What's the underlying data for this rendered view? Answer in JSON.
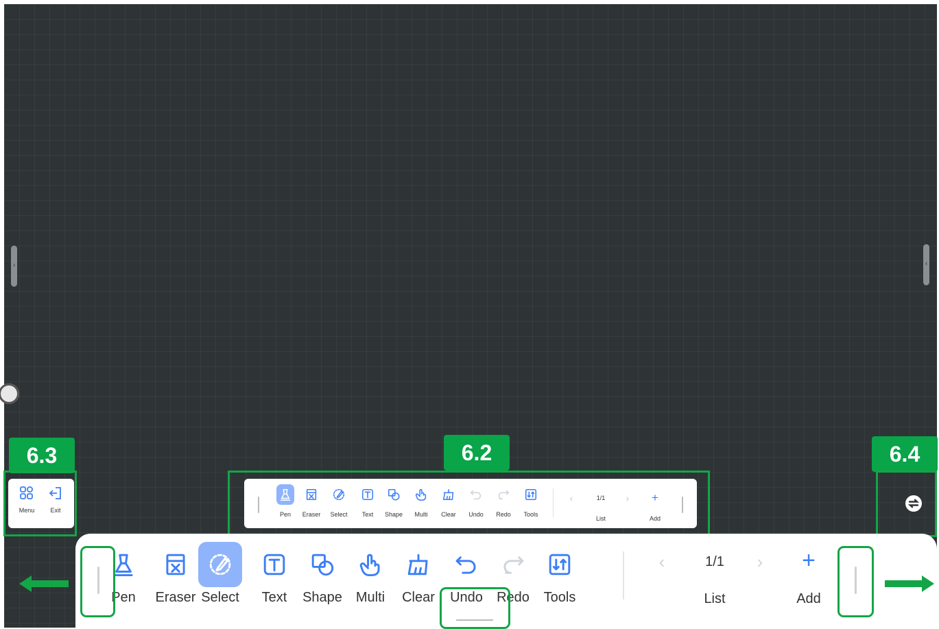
{
  "callouts": {
    "left": "6.3",
    "center": "6.2",
    "right": "6.4"
  },
  "colors": {
    "accent": "#3d7ff5",
    "active_bg": "#8fb4fb",
    "callout_green": "#0aa449",
    "canvas": "#2e3436",
    "disabled": "#cfd4da"
  },
  "left_panel": {
    "menu": {
      "label": "Menu",
      "icon": "menu-grid-icon"
    },
    "exit": {
      "label": "Exit",
      "icon": "exit-icon"
    }
  },
  "small_toolbar": {
    "tools": [
      {
        "label": "Pen",
        "icon": "pen-icon",
        "active": true
      },
      {
        "label": "Eraser",
        "icon": "eraser-icon"
      },
      {
        "label": "Select",
        "icon": "select-icon"
      },
      {
        "label": "Text",
        "icon": "text-icon"
      },
      {
        "label": "Shape",
        "icon": "shape-icon"
      },
      {
        "label": "Multi",
        "icon": "multi-touch-icon"
      },
      {
        "label": "Clear",
        "icon": "clear-icon"
      },
      {
        "label": "Undo",
        "icon": "undo-icon",
        "disabled": true
      },
      {
        "label": "Redo",
        "icon": "redo-icon",
        "disabled": true
      },
      {
        "label": "Tools",
        "icon": "tools-icon"
      }
    ],
    "page": "1/1",
    "list_label": "List",
    "add_label": "Add"
  },
  "main_toolbar": {
    "tools": [
      {
        "label": "Pen",
        "icon": "pen-icon"
      },
      {
        "label": "Eraser",
        "icon": "eraser-icon"
      },
      {
        "label": "Select",
        "icon": "select-icon",
        "active": true
      },
      {
        "label": "Text",
        "icon": "text-icon"
      },
      {
        "label": "Shape",
        "icon": "shape-icon"
      },
      {
        "label": "Multi",
        "icon": "multi-touch-icon"
      },
      {
        "label": "Clear",
        "icon": "clear-icon"
      },
      {
        "label": "Undo",
        "icon": "undo-icon"
      },
      {
        "label": "Redo",
        "icon": "redo-icon",
        "disabled": true
      },
      {
        "label": "Tools",
        "icon": "tools-icon"
      }
    ],
    "page": "1/1",
    "list_label": "List",
    "add_label": "Add"
  },
  "right_panel": {
    "icon": "swap-icon"
  }
}
